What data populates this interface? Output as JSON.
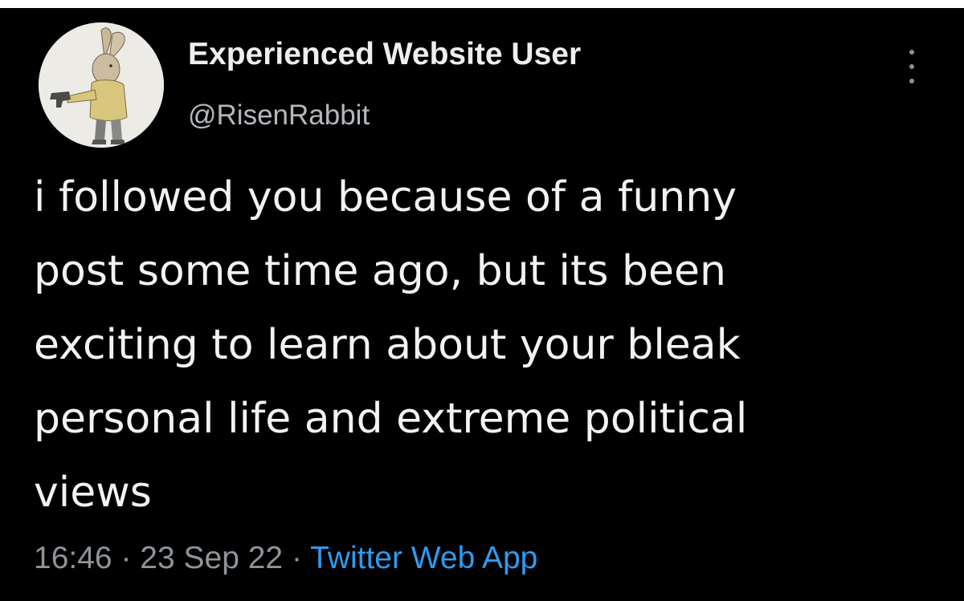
{
  "tweet": {
    "author": {
      "display_name": "Experienced Website User",
      "handle": "@RisenRabbit",
      "avatar_icon": "rabbit-holding-gun-illustration"
    },
    "more_icon": "vertical-ellipsis-icon",
    "text_lines": [
      "i followed you because of a funny",
      "post some time ago, but its been",
      "exciting to learn about your bleak",
      "personal life and extreme political",
      "views"
    ],
    "meta": {
      "time": "16:46",
      "separator": "·",
      "date": "23 Sep 22",
      "source": "Twitter Web App"
    }
  },
  "colors": {
    "background": "#000000",
    "text": "#f2f2f2",
    "secondary": "#8e9499",
    "link": "#2d9bf0"
  }
}
